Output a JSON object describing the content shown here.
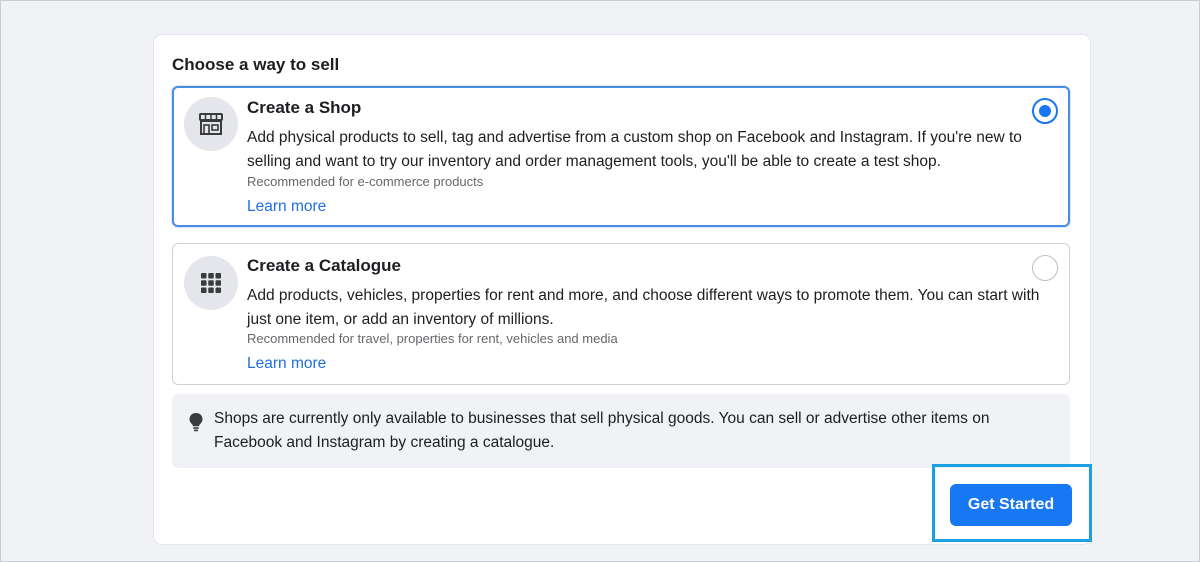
{
  "page": {
    "title": "Choose a way to sell"
  },
  "options": [
    {
      "title": "Create a Shop",
      "description": "Add physical products to sell, tag and advertise from a custom shop on Facebook and Instagram. If you're new to selling and want to try our inventory and order management tools, you'll be able to create a test shop.",
      "recommendation": "Recommended for e-commerce products",
      "learn_more": "Learn more",
      "icon": "storefront-icon",
      "selected": true
    },
    {
      "title": "Create a Catalogue",
      "description": "Add products, vehicles, properties for rent and more, and choose different ways to promote them. You can start with just one item, or add an inventory of millions.",
      "recommendation": "Recommended for travel, properties for rent, vehicles and media",
      "learn_more": "Learn more",
      "icon": "grid-icon",
      "selected": false
    }
  ],
  "notice": {
    "icon": "lightbulb-icon",
    "text": "Shops are currently only available to businesses that sell physical goods. You can sell or advertise other items on Facebook and Instagram by creating a catalogue."
  },
  "actions": {
    "primary_label": "Get Started"
  },
  "colors": {
    "accent": "#1877f2",
    "link": "#216fdb",
    "highlight": "#1ba1e2",
    "background": "#f0f2f5"
  }
}
